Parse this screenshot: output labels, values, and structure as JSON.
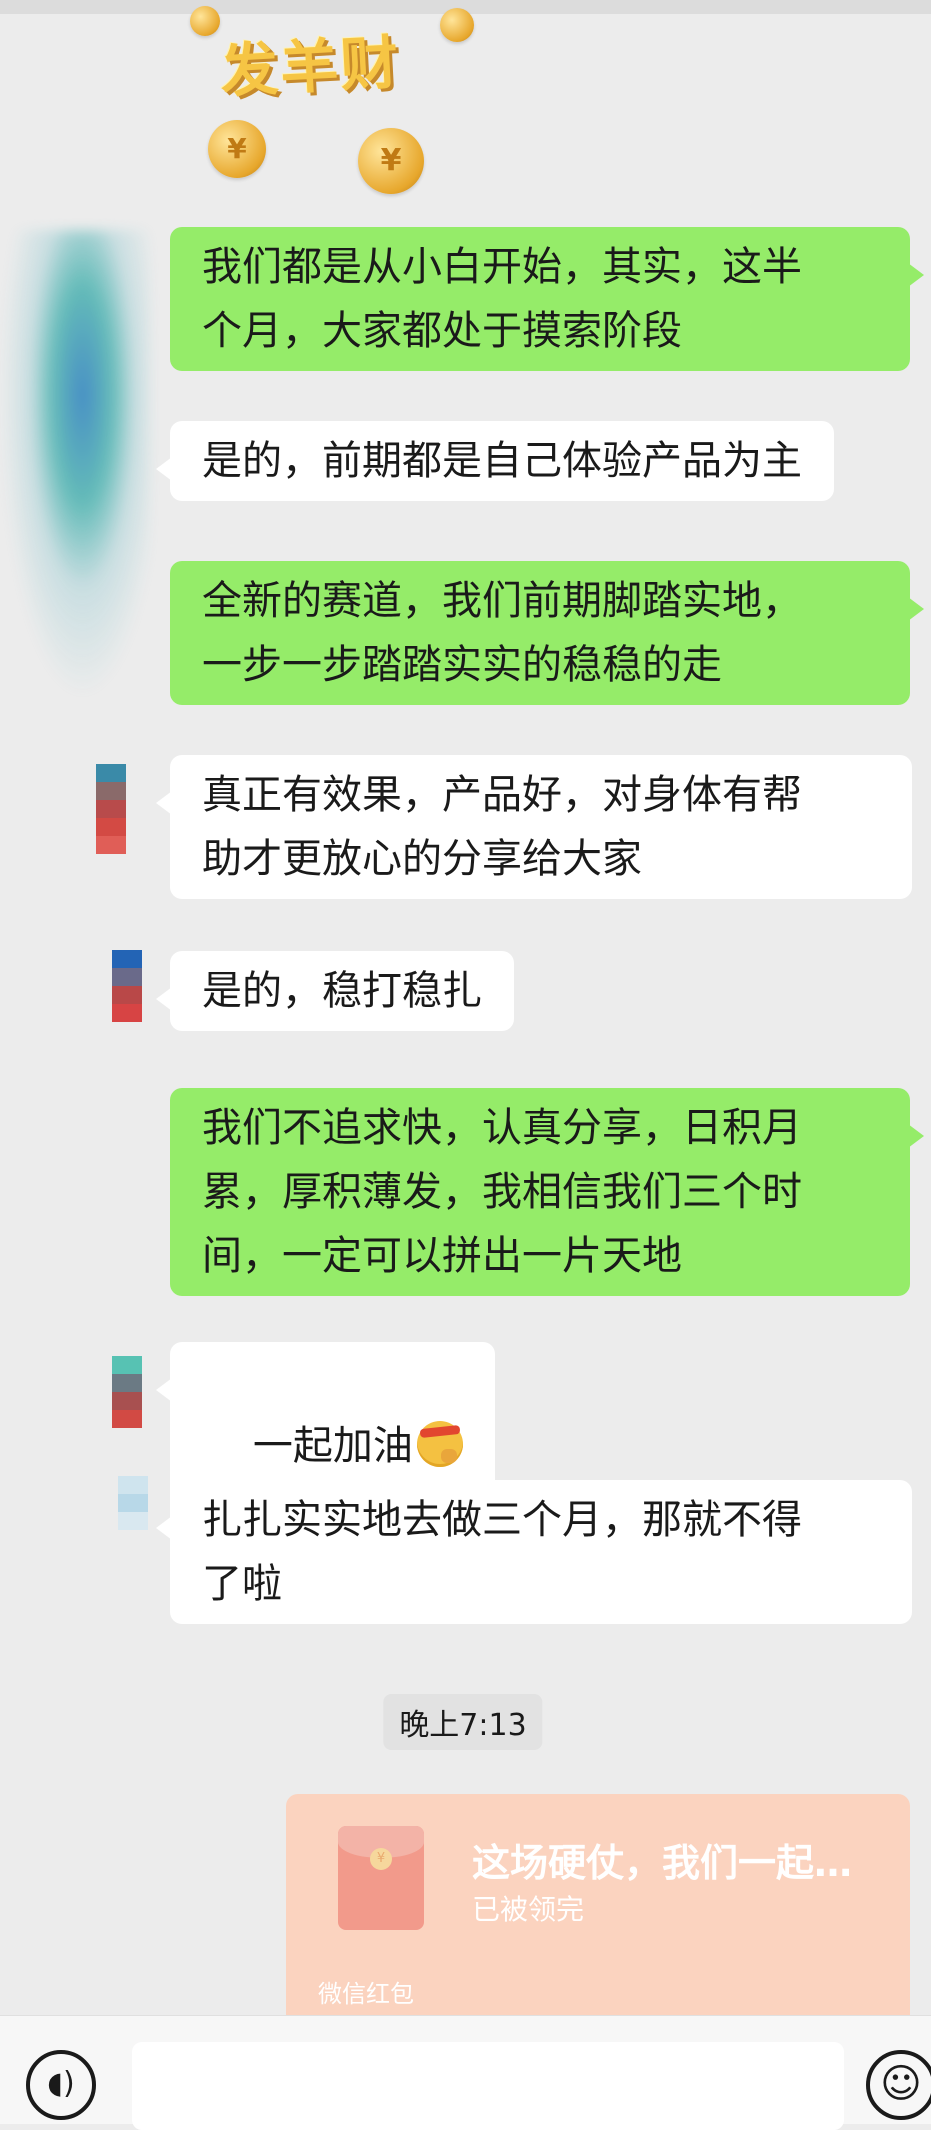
{
  "sticker": {
    "text": "发羊财",
    "coin_symbol": "¥"
  },
  "messages": [
    {
      "side": "sent",
      "text": "我们都是从小白开始，其实，这半\n个月，大家都处于摸索阶段"
    },
    {
      "side": "recv",
      "text": "是的，前期都是自己体验产品为主"
    },
    {
      "side": "sent",
      "text": "全新的赛道，我们前期脚踏实地，\n一步一步踏踏实实的稳稳的走"
    },
    {
      "side": "recv",
      "text": "真正有效果，产品好，对身体有帮\n助才更放心的分享给大家"
    },
    {
      "side": "recv",
      "text": "是的，稳打稳扎"
    },
    {
      "side": "sent",
      "text": "我们不追求快，认真分享，日积月\n累，厚积薄发，我相信我们三个时\n间，一定可以拼出一片天地"
    },
    {
      "side": "recv",
      "text": "一起加油",
      "emoji": "salute-emoji"
    },
    {
      "side": "recv",
      "text": "扎扎实实地去做三个月，那就不得\n了啦"
    }
  ],
  "timestamp": "晚上7:13",
  "red_packet": {
    "title": "这场硬仗，我们一起…",
    "status": "已被领完",
    "footer": "微信红包",
    "seal": "¥"
  },
  "input_bar": {
    "voice_icon": "voice-icon",
    "emoji_icon": "emoji-icon",
    "text_value": ""
  },
  "colors": {
    "sent_bubble": "#95ec69",
    "recv_bubble": "#ffffff",
    "chat_bg": "#ececec",
    "red_packet_bg": "#fbd3bf"
  }
}
